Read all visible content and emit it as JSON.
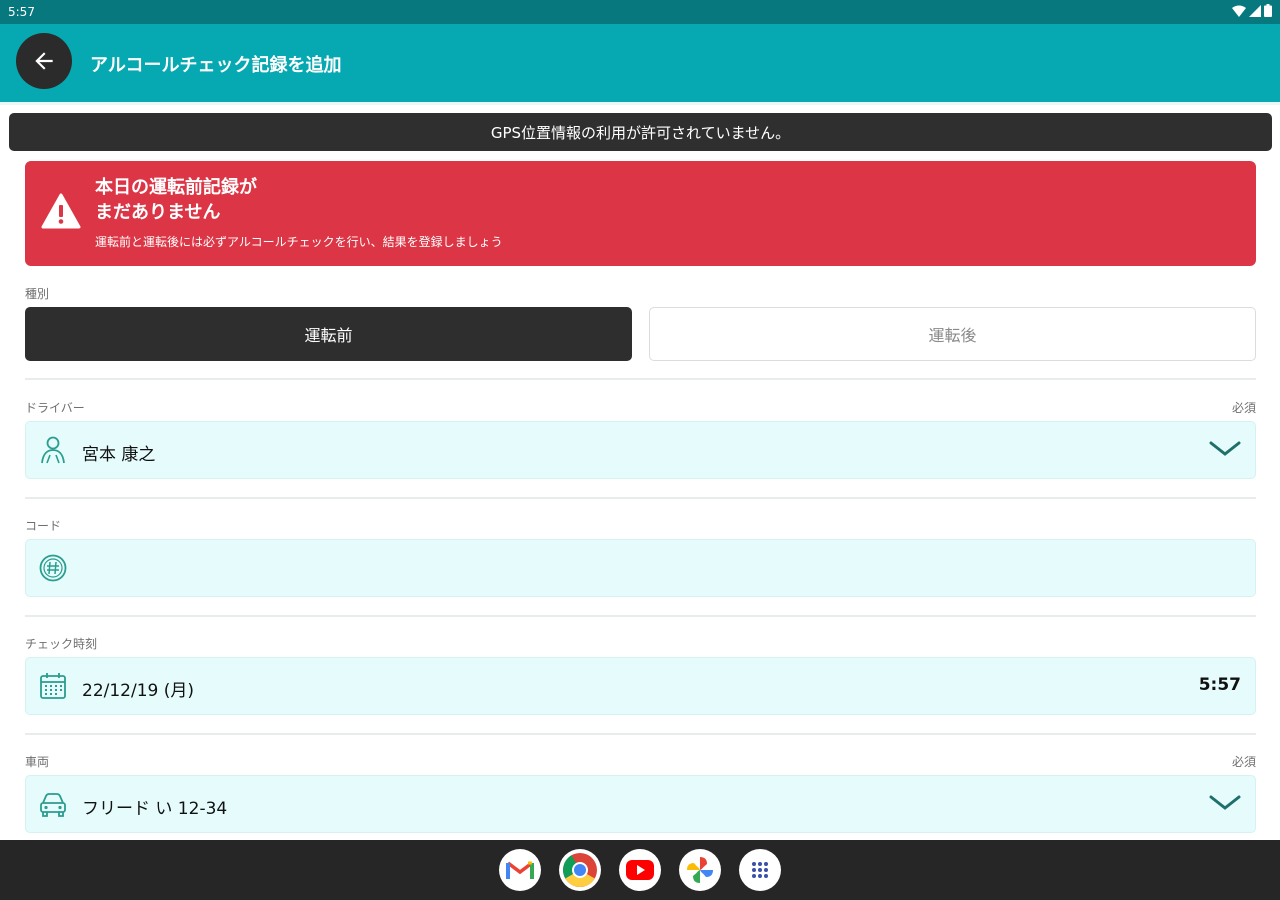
{
  "status_bar": {
    "time": "5:57"
  },
  "app_bar": {
    "title": "アルコールチェック記録を追加"
  },
  "gps_banner": "GPS位置情報の利用が許可されていません。",
  "alert": {
    "title_line1": "本日の運転前記録が",
    "title_line2": "まだありません",
    "description": "運転前と運転後には必ずアルコールチェックを行い、結果を登録しましょう"
  },
  "type_section": {
    "label": "種別",
    "options": [
      "運転前",
      "運転後"
    ],
    "selected": "運転前"
  },
  "driver": {
    "label": "ドライバー",
    "required": "必須",
    "value": "宮本 康之",
    "icon": "person-icon"
  },
  "code": {
    "label": "コード",
    "value": "",
    "icon": "code-icon"
  },
  "check_time": {
    "label": "チェック時刻",
    "date": "22/12/19 (月)",
    "time": "5:57",
    "icon": "calendar-icon"
  },
  "vehicle": {
    "label": "車両",
    "required": "必須",
    "value": "フリード い 12-34",
    "icon": "car-icon"
  },
  "dock_apps": [
    "gmail-icon",
    "chrome-icon",
    "youtube-icon",
    "photos-icon",
    "app-drawer-icon"
  ],
  "colors": {
    "teal": "#06a8b1",
    "alert_red": "#dc3545",
    "field_bg": "#e6fcfc",
    "dark": "#2e2e2e"
  }
}
